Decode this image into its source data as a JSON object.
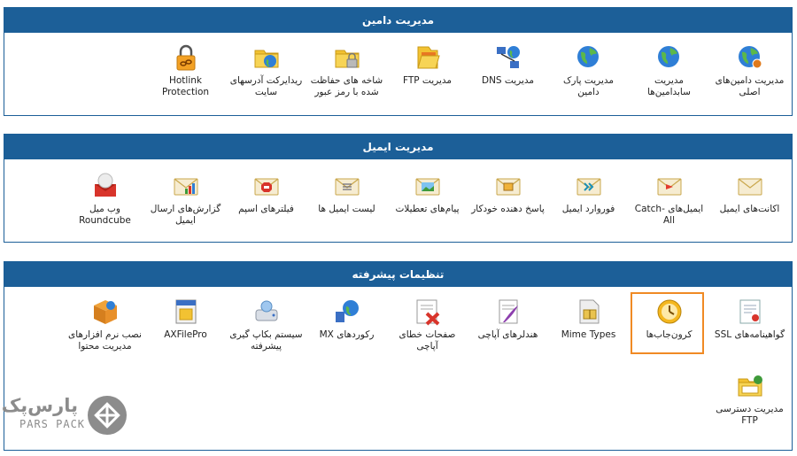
{
  "panels": {
    "domain": {
      "title": "مدیریت دامین",
      "items": [
        {
          "label": "مدیریت دامین‌های اصلی",
          "icon": "globe-gear-icon"
        },
        {
          "label": "مدیریت سابدامین‌ها",
          "icon": "globe-icon"
        },
        {
          "label": "مدیریت پارک دامین",
          "icon": "globe-icon"
        },
        {
          "label": "مدیریت DNS",
          "icon": "network-globe-icon"
        },
        {
          "label": "مدیریت FTP",
          "icon": "folder-icon"
        },
        {
          "label": "شاخه های حفاظت شده با رمز عبور",
          "icon": "folder-lock-icon"
        },
        {
          "label": "ریدایرکت آدرسهای سایت",
          "icon": "folder-globe-icon"
        },
        {
          "label": "Hotlink Protection",
          "icon": "padlock-link-icon"
        }
      ]
    },
    "email": {
      "title": "مدیریت ایمیل",
      "items": [
        {
          "label": "اکانت‌های ایمیل",
          "icon": "envelope-icon"
        },
        {
          "label": "ایمیل‌های Catch-All",
          "icon": "envelope-arrow-icon"
        },
        {
          "label": "فوروارد ایمیل",
          "icon": "envelope-forward-icon"
        },
        {
          "label": "پاسخ دهنده خودکار",
          "icon": "envelope-reply-icon"
        },
        {
          "label": "پیام‌های تعطیلات",
          "icon": "envelope-landscape-icon"
        },
        {
          "label": "لیست ایمیل ها",
          "icon": "envelope-list-icon"
        },
        {
          "label": "فیلترهای اسپم",
          "icon": "envelope-stop-icon"
        },
        {
          "label": "گزارش‌های ارسال ایمیل",
          "icon": "envelope-chart-icon"
        },
        {
          "label": "وب میل Roundcube",
          "icon": "webmail-icon"
        }
      ]
    },
    "advanced": {
      "title": "تنظیمات پیشرفته",
      "items": [
        {
          "label": "گواهینامه‌های SSL",
          "icon": "certificate-icon"
        },
        {
          "label": "کرون‌جاب‌ها",
          "icon": "clock-icon"
        },
        {
          "label": "Mime Types",
          "icon": "zip-file-icon"
        },
        {
          "label": "هندلرهای آپاچی",
          "icon": "document-feather-icon"
        },
        {
          "label": "صفحات خطای آپاچی",
          "icon": "error-page-icon"
        },
        {
          "label": "رکوردهای MX",
          "icon": "mx-globe-icon"
        },
        {
          "label": "سیستم بکاپ گیری پیشرفته",
          "icon": "backup-disk-icon"
        },
        {
          "label": "AXFilePro",
          "icon": "file-manager-icon"
        },
        {
          "label": "نصب نرم افزارهای مدیریت محتوا",
          "icon": "package-icon"
        },
        {
          "label": "مدیریت دسترسی FTP",
          "icon": "ftp-folder-icon"
        }
      ]
    }
  },
  "logo": {
    "fa": "پارس‌پک",
    "en": "PARS PACK"
  },
  "colors": {
    "header": "#1c5f98",
    "highlight": "#f08a24"
  }
}
